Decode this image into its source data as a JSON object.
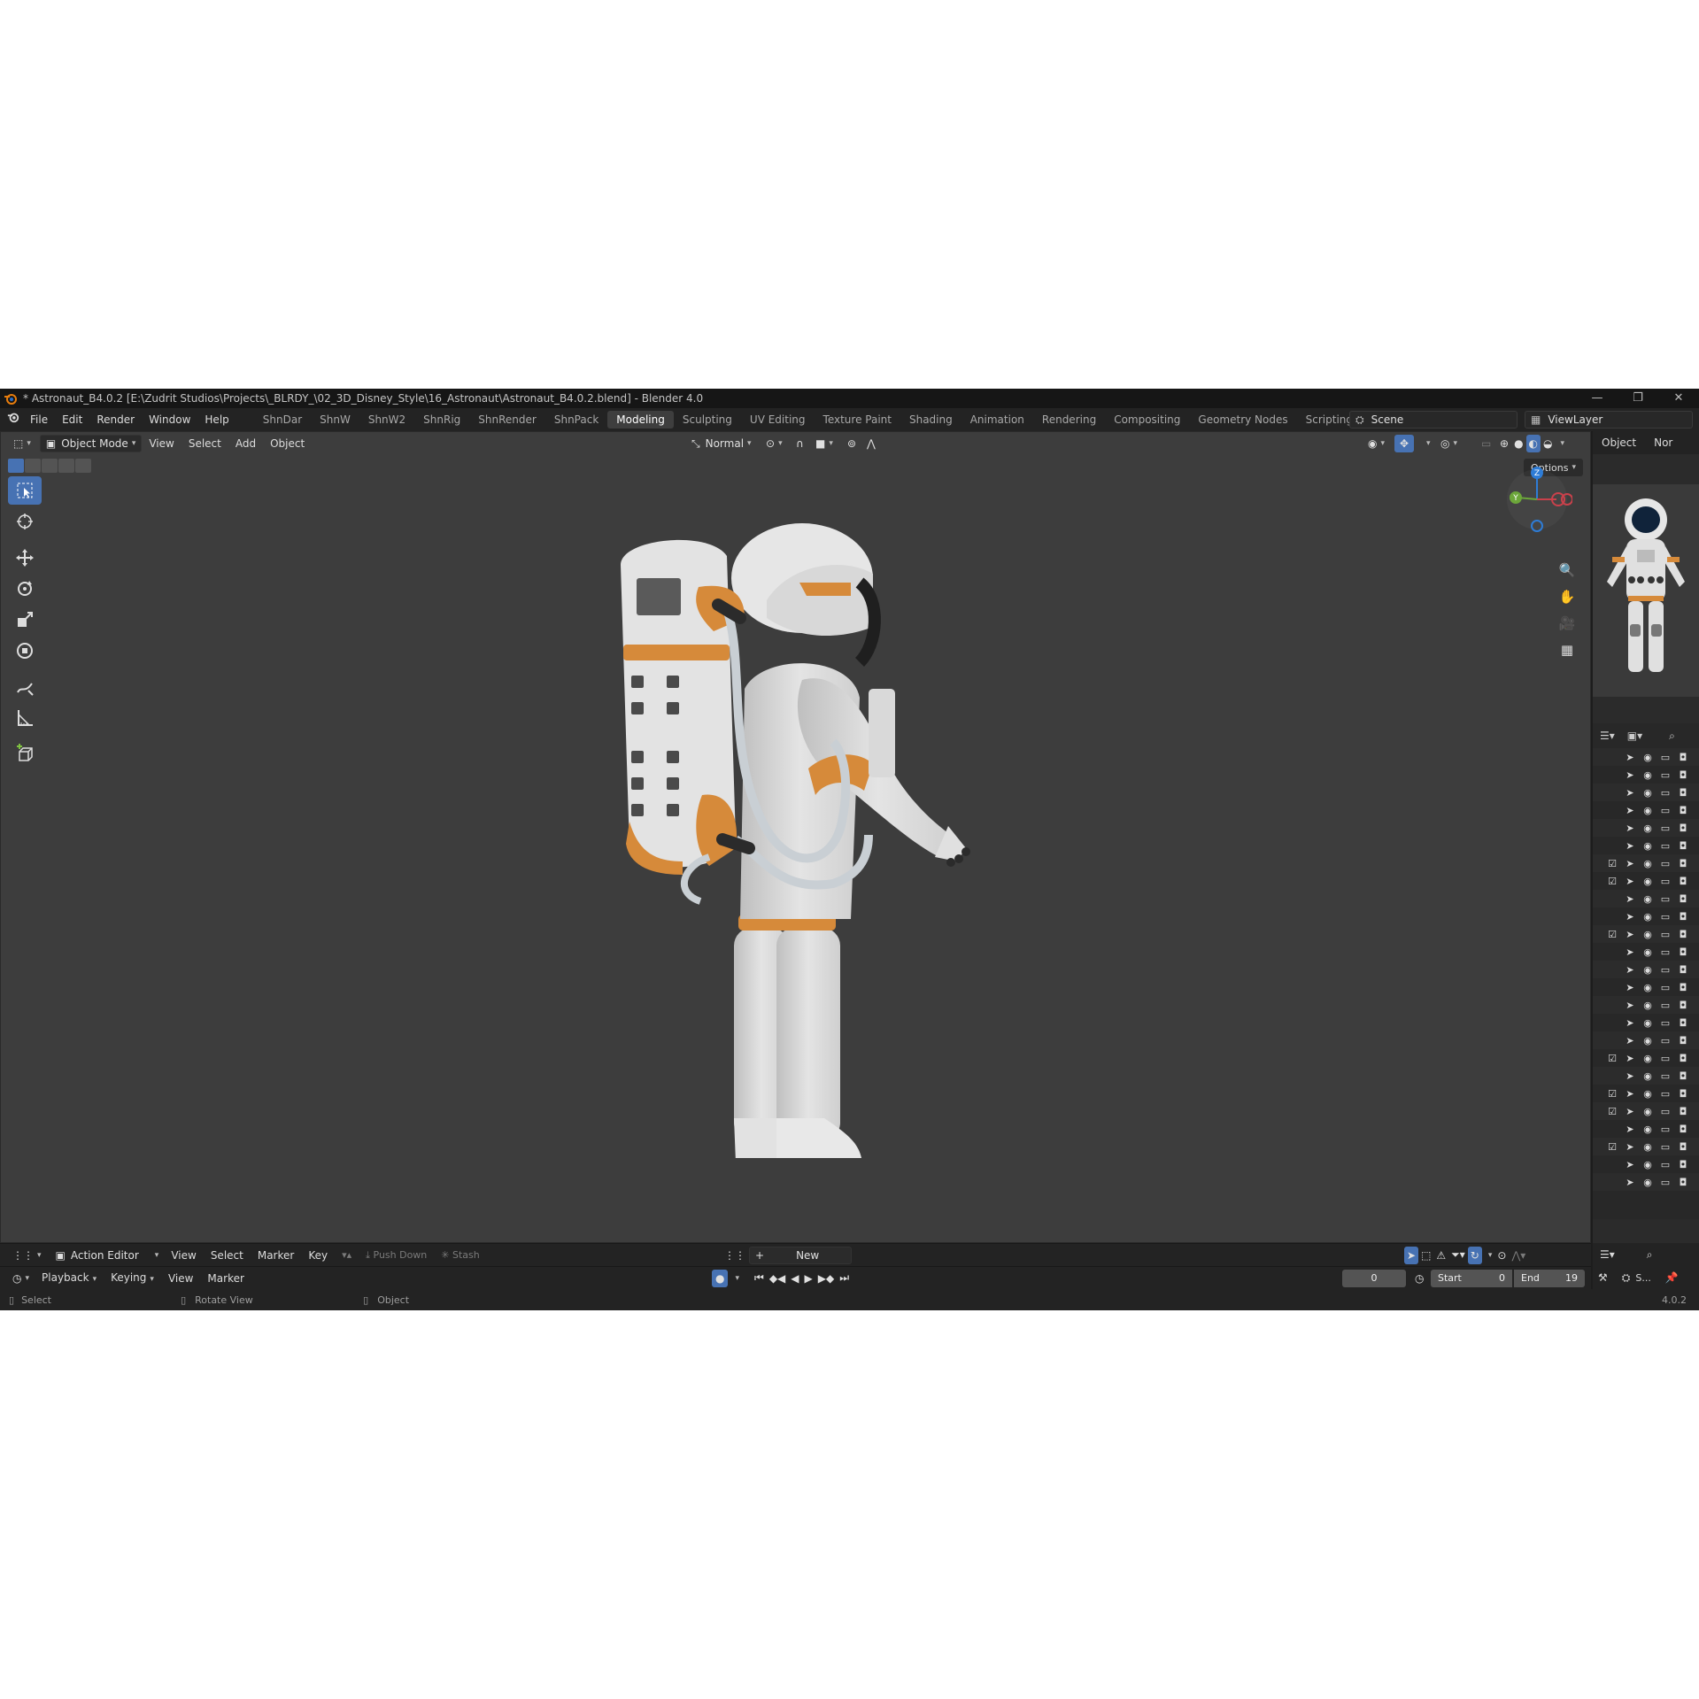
{
  "window": {
    "title": "* Astronaut_B4.0.2 [E:\\Zudrit Studios\\Projects\\_BLRDY_\\02_3D_Disney_Style\\16_Astronaut\\Astronaut_B4.0.2.blend] - Blender 4.0",
    "controls": [
      "—",
      "❐",
      "✕"
    ]
  },
  "menu": [
    "File",
    "Edit",
    "Render",
    "Window",
    "Help"
  ],
  "workspaces": [
    "ShnDar",
    "ShnW",
    "ShnW2",
    "ShnRig",
    "ShnRender",
    "ShnPack",
    "Modeling",
    "Sculpting",
    "UV Editing",
    "Texture Paint",
    "Shading",
    "Animation",
    "Rendering",
    "Compositing",
    "Geometry Nodes",
    "Scripting"
  ],
  "active_workspace": "Modeling",
  "add_workspace": "+",
  "scene": {
    "label": "Scene",
    "viewlayer": "ViewLayer"
  },
  "viewport": {
    "mode": "Object Mode",
    "menus": [
      "View",
      "Select",
      "Add",
      "Object"
    ],
    "orientation": "Normal",
    "options": "Options",
    "gizmo": {
      "z": "Z",
      "y": "Y"
    }
  },
  "properties": {
    "tabs": [
      "Object",
      "Nor"
    ]
  },
  "outliner": {
    "rows": [
      {
        "check": false,
        "enabled": true
      },
      {
        "check": false,
        "enabled": true
      },
      {
        "check": false,
        "enabled": true
      },
      {
        "check": false,
        "enabled": true
      },
      {
        "check": false,
        "enabled": true
      },
      {
        "check": false,
        "enabled": true
      },
      {
        "check": true,
        "enabled": true
      },
      {
        "check": true,
        "enabled": true
      },
      {
        "check": false,
        "enabled": true
      },
      {
        "check": false,
        "enabled": true
      },
      {
        "check": true,
        "enabled": true
      },
      {
        "check": false,
        "enabled": true
      },
      {
        "check": false,
        "enabled": true
      },
      {
        "check": false,
        "enabled": true
      },
      {
        "check": false,
        "enabled": true
      },
      {
        "check": false,
        "enabled": true
      },
      {
        "check": false,
        "enabled": true
      },
      {
        "check": true,
        "enabled": true
      },
      {
        "check": false,
        "enabled": true
      },
      {
        "check": true,
        "enabled": true
      },
      {
        "check": true,
        "enabled": true
      },
      {
        "check": false,
        "enabled": true
      },
      {
        "check": true,
        "enabled": false
      },
      {
        "check": false,
        "enabled": false
      },
      {
        "check": false,
        "enabled": true
      }
    ]
  },
  "action_editor": {
    "mode": "Action Editor",
    "menus": [
      "View",
      "Select",
      "Marker",
      "Key"
    ],
    "push_down": "Push Down",
    "stash": "Stash",
    "new": "New"
  },
  "timeline": {
    "menus": [
      "Playback",
      "Keying",
      "View",
      "Marker"
    ],
    "current_frame": "0",
    "start_label": "Start",
    "start": "0",
    "end_label": "End",
    "end": "19"
  },
  "right_bottom": {
    "scene_short": "S..."
  },
  "status": {
    "select": "Select",
    "rotate": "Rotate View",
    "object": "Object",
    "version": "4.0.2"
  },
  "colors": {
    "accent": "#4772b3",
    "orange": "#d68a3a",
    "viewport_bg": "#3d3d3d"
  }
}
